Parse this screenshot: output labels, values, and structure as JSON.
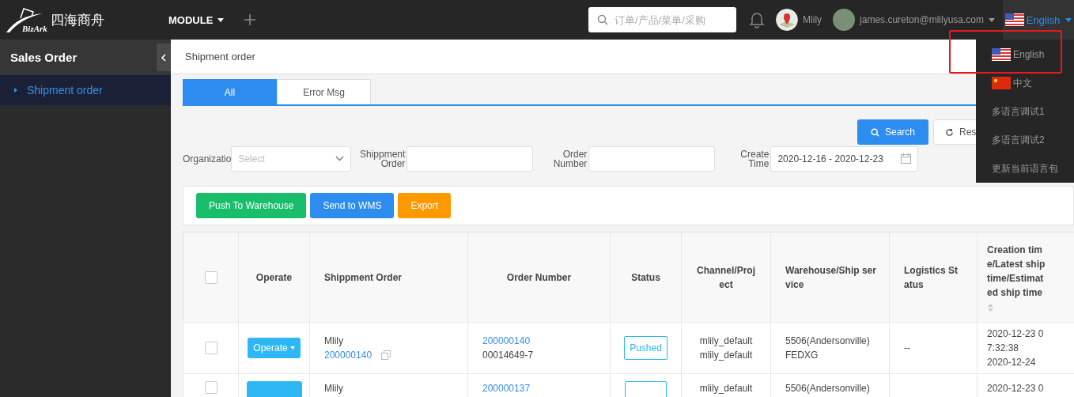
{
  "topbar": {
    "logo_text": "BizArk",
    "brand": "四海商舟",
    "module_menu": "MODULE",
    "search": {
      "placeholder": "订单/产品/菜单/采购"
    },
    "store_name": "Mlily",
    "user_email": "james.cureton@mlilyusa.com",
    "language": "English"
  },
  "sidebar": {
    "title": "Sales Order",
    "items": [
      {
        "label": "Shipment order",
        "selected": true
      }
    ]
  },
  "breadcrumb": "Shipment order",
  "tabs": [
    {
      "label": "All",
      "selected": true
    },
    {
      "label": "Error Msg",
      "selected": false
    }
  ],
  "search_buttons": {
    "search": "Search",
    "reset": "Res"
  },
  "filters": [
    {
      "kind": "select",
      "label": "Organizatio",
      "placeholder": "Select"
    },
    {
      "kind": "input",
      "label": "Shippment Order"
    },
    {
      "kind": "input",
      "label": "Order Number"
    },
    {
      "kind": "date",
      "label": "Create Time",
      "value": "2020-12-16 - 2020-12-23"
    }
  ],
  "actions": [
    {
      "label": "Push To Warehouse",
      "color": "#19be6b"
    },
    {
      "label": "Send to WMS",
      "color": "#2d8cf0"
    },
    {
      "label": "Export",
      "color": "#ff9900"
    }
  ],
  "table": {
    "columns": [
      "Operate",
      "Shippment Order",
      "Order Number",
      "Status",
      "Channel/Project",
      "Warehouse/Ship service",
      "Logistics Status",
      "Creation time/Latest ship time/Estimated ship time"
    ],
    "select_all": false,
    "rows": [
      {
        "checked": false,
        "operate": "Operate",
        "shipment_name": "Mlily",
        "shipment_no": "200000140",
        "order_no": "200000140",
        "order_ref": "00014649-7",
        "status": "Pushed",
        "channels": [
          "mlily_default",
          "mlily_default"
        ],
        "warehouse": "5506(Andersonville)",
        "ship_service": "FEDXG",
        "logistics": "--",
        "times": [
          "2020-12-23 07:32:38",
          "2020-12-24"
        ]
      },
      {
        "checked": false,
        "shipment_name": "Mlily",
        "order_no": "200000137",
        "channels": [
          "mlily_default"
        ],
        "warehouse": "5506(Andersonville)",
        "times": [
          "2020-12-23 0"
        ]
      }
    ]
  },
  "language_menu": {
    "items": [
      {
        "label": "English",
        "kind": "usflag",
        "highlighted": true
      },
      {
        "label": "中文",
        "kind": "cnflag",
        "highlighted": false
      },
      {
        "label": "多语言调试1",
        "kind": "text",
        "highlighted": false
      },
      {
        "label": "多语言调试2",
        "kind": "text",
        "highlighted": false
      },
      {
        "label": "更新当前语言包",
        "kind": "text",
        "highlighted": false
      }
    ]
  }
}
